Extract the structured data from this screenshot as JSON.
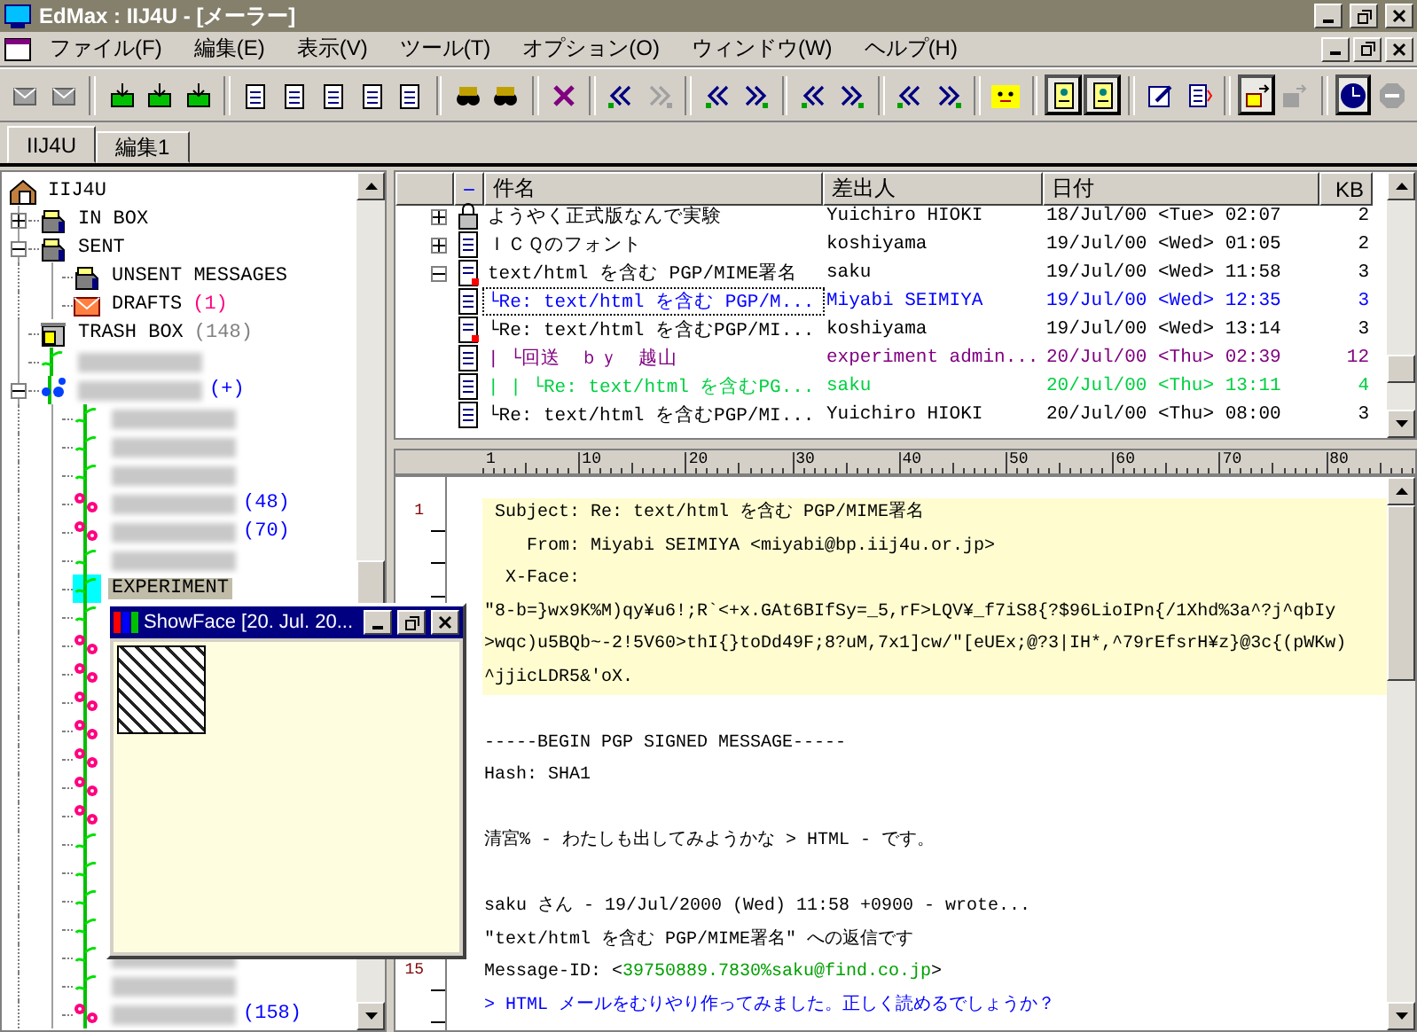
{
  "window": {
    "title": "EdMax : IIJ4U - [メーラー]"
  },
  "menu": [
    "ファイル(F)",
    "編集(E)",
    "表示(V)",
    "ツール(T)",
    "オプション(O)",
    "ウィンドウ(W)",
    "ヘルプ(H)"
  ],
  "toolbar": [
    {
      "kind": "mail",
      "pressed": false,
      "disabled": true
    },
    {
      "kind": "mail",
      "pressed": false,
      "disabled": true
    },
    {
      "kind": "separator"
    },
    {
      "kind": "tray",
      "pressed": false,
      "disabled": false
    },
    {
      "kind": "tray",
      "pressed": false,
      "disabled": false
    },
    {
      "kind": "tray",
      "pressed": false,
      "disabled": false
    },
    {
      "kind": "separator"
    },
    {
      "kind": "doc",
      "pressed": false,
      "disabled": false
    },
    {
      "kind": "doc",
      "pressed": false,
      "disabled": false
    },
    {
      "kind": "doc",
      "pressed": false,
      "disabled": false
    },
    {
      "kind": "doc",
      "pressed": false,
      "disabled": false
    },
    {
      "kind": "doc",
      "pressed": false,
      "disabled": false
    },
    {
      "kind": "separator"
    },
    {
      "kind": "find",
      "pressed": false,
      "disabled": false
    },
    {
      "kind": "find",
      "pressed": false,
      "disabled": false
    },
    {
      "kind": "separator"
    },
    {
      "kind": "delete",
      "pressed": false,
      "disabled": false
    },
    {
      "kind": "separator"
    },
    {
      "kind": "prev",
      "pressed": false,
      "disabled": false
    },
    {
      "kind": "next",
      "pressed": false,
      "disabled": true
    },
    {
      "kind": "separator"
    },
    {
      "kind": "prev",
      "pressed": false,
      "disabled": false
    },
    {
      "kind": "next",
      "pressed": false,
      "disabled": false
    },
    {
      "kind": "separator"
    },
    {
      "kind": "prev",
      "pressed": false,
      "disabled": false
    },
    {
      "kind": "next",
      "pressed": false,
      "disabled": false
    },
    {
      "kind": "separator"
    },
    {
      "kind": "prev",
      "pressed": false,
      "disabled": false
    },
    {
      "kind": "next",
      "pressed": false,
      "disabled": false
    },
    {
      "kind": "separator"
    },
    {
      "kind": "face",
      "pressed": false,
      "disabled": false
    },
    {
      "kind": "separator"
    },
    {
      "kind": "page",
      "pressed": true,
      "disabled": false
    },
    {
      "kind": "page",
      "pressed": true,
      "disabled": false
    },
    {
      "kind": "separator"
    },
    {
      "kind": "edit",
      "pressed": false,
      "disabled": false
    },
    {
      "kind": "list",
      "pressed": false,
      "disabled": false
    },
    {
      "kind": "separator"
    },
    {
      "kind": "move",
      "pressed": true,
      "disabled": false
    },
    {
      "kind": "move",
      "pressed": false,
      "disabled": true
    },
    {
      "kind": "separator"
    },
    {
      "kind": "clock",
      "pressed": true,
      "disabled": false
    },
    {
      "kind": "stop",
      "pressed": false,
      "disabled": true
    }
  ],
  "tabs": [
    {
      "label": "IIJ4U",
      "selected": true
    },
    {
      "label": "編集1",
      "selected": false
    }
  ],
  "tree": {
    "label": "IIJ4U",
    "kind": "account",
    "selected": false,
    "children": [
      {
        "label": "IN BOX",
        "kind": "mailbox",
        "expanded": false,
        "selected": false
      },
      {
        "label": "SENT",
        "kind": "mailbox",
        "expanded": true,
        "selected": false,
        "children": [
          {
            "label": "UNSENT MESSAGES",
            "kind": "mailbox",
            "selected": false
          },
          {
            "label": "DRAFTS",
            "kind": "envelope",
            "count": "(1)",
            "color": "#ff0080",
            "selected": false
          }
        ]
      },
      {
        "label": "TRASH BOX",
        "kind": "trash",
        "count": "(148)",
        "color": "#808080",
        "selected": false
      },
      {
        "kind": "vine",
        "blurred": true,
        "selected": false
      },
      {
        "kind": "blue-flower",
        "blurred": true,
        "count": "(+)",
        "color": "#0000ff",
        "expanded": true,
        "selected": false,
        "children": [
          {
            "kind": "vine",
            "blurred": true,
            "selected": false
          },
          {
            "kind": "vine",
            "blurred": true,
            "selected": false
          },
          {
            "kind": "vine",
            "blurred": true,
            "selected": false
          },
          {
            "kind": "pink-flower",
            "blurred": true,
            "count": "(48)",
            "color": "#0000ff",
            "selected": false
          },
          {
            "kind": "pink-flower",
            "blurred": true,
            "count": "(70)",
            "color": "#0000ff",
            "selected": false
          },
          {
            "kind": "vine",
            "blurred": true,
            "selected": false
          },
          {
            "label": "EXPERIMENT",
            "kind": "vine",
            "selected": true
          },
          {
            "kind": "vine",
            "selected": false
          },
          {
            "kind": "pink-flower",
            "selected": false
          },
          {
            "kind": "pink-flower",
            "selected": false
          },
          {
            "kind": "pink-flower",
            "selected": false
          },
          {
            "kind": "pink-flower",
            "selected": false
          },
          {
            "kind": "pink-flower",
            "selected": false
          },
          {
            "kind": "pink-flower",
            "selected": false
          },
          {
            "kind": "pink-flower",
            "selected": false
          },
          {
            "kind": "vine",
            "selected": false
          },
          {
            "kind": "vine",
            "selected": false
          },
          {
            "kind": "vine",
            "selected": false
          },
          {
            "kind": "vine",
            "selected": false
          },
          {
            "kind": "vine",
            "blurred": true,
            "selected": false
          },
          {
            "kind": "vine",
            "blurred": true,
            "selected": false
          },
          {
            "kind": "pink-flower",
            "blurred": true,
            "count": "(158)",
            "color": "#0000ff",
            "selected": false
          }
        ]
      }
    ]
  },
  "message_list": {
    "columns": [
      "−",
      "件名",
      "差出人",
      "日付",
      "KB"
    ],
    "rows": [
      {
        "expanded": false,
        "kind": "lock",
        "subject": "ようやく正式版なんで実験",
        "sender": "Yuichiro HIOKI",
        "date": "18/Jul/00 <Tue> 02:07",
        "kb": "2",
        "color": "#000000",
        "selected": false
      },
      {
        "expanded": false,
        "kind": "doc",
        "subject": "ＩＣＱのフォント",
        "sender": "koshiyama",
        "date": "19/Jul/00 <Wed> 01:05",
        "kb": "2",
        "color": "#000000",
        "selected": false
      },
      {
        "expanded": true,
        "kind": "signed",
        "subject": "text/html を含む PGP/MIME署名",
        "sender": "saku",
        "date": "19/Jul/00 <Wed> 11:58",
        "kb": "3",
        "color": "#000000",
        "selected": false
      },
      {
        "kind": "doc",
        "subject": "└Re: text/html を含む PGP/M...",
        "sender": "Miyabi SEIMIYA",
        "date": "19/Jul/00 <Wed> 12:35",
        "kb": "3",
        "color": "#0000ff",
        "selected": true
      },
      {
        "kind": "signed",
        "subject": "└Re: text/html を含むPGP/MI...",
        "sender": "koshiyama",
        "date": "19/Jul/00 <Wed> 13:14",
        "kb": "3",
        "color": "#000000",
        "selected": false
      },
      {
        "kind": "doc",
        "subject": "| └回送　ｂｙ　越山",
        "sender": "experiment admin...",
        "date": "20/Jul/00 <Thu> 02:39",
        "kb": "12",
        "color": "#800080",
        "selected": false
      },
      {
        "kind": "doc",
        "subject": "| | └Re: text/html を含むPG...",
        "sender": "saku",
        "date": "20/Jul/00 <Thu> 13:11",
        "kb": "4",
        "color": "#00d040",
        "selected": false
      },
      {
        "kind": "doc",
        "subject": "└Re: text/html を含むPGP/MI...",
        "sender": "Yuichiro HIOKI",
        "date": "20/Jul/00 <Thu> 08:00",
        "kb": "3",
        "color": "#000000",
        "selected": false
      }
    ]
  },
  "ruler": [
    "1",
    "10",
    "20",
    "30",
    "40",
    "50",
    "60",
    "70",
    "80"
  ],
  "message_body": {
    "lines": [
      {
        "kind": "header",
        "number": "1",
        "label": "Subject:",
        "text": "Re: text/html を含む PGP/MIME署名"
      },
      {
        "kind": "header",
        "label": "From:",
        "text": "Miyabi SEIMIYA <miyabi@bp.iij4u.or.jp>"
      },
      {
        "kind": "header",
        "label": "X-Face:"
      },
      {
        "kind": "header",
        "text": "\"8-b=}wx9K%M)qy¥u6!;R`<+x.GAt6BIfSy=_5,rF>LQV¥_f7iS8{?$96LioIPn{/1Xhd%3a^?j^qbIy"
      },
      {
        "kind": "header",
        "text": ">wqc)u5BQb~-2!5V60>thI{}toDd49F;8?uM,7x1]cw/\"[eUEx;@?3|IH*,^79rEfsrH¥z}@3c{(pWKw)"
      },
      {
        "kind": "header",
        "text": "^jjicLDR5&'oX."
      },
      {
        "kind": "blank"
      },
      {
        "kind": "text",
        "text": "-----BEGIN PGP SIGNED MESSAGE-----"
      },
      {
        "kind": "text",
        "text": "Hash: SHA1"
      },
      {
        "kind": "blank"
      },
      {
        "kind": "text",
        "text": "清宮% - わたしも出してみようかな > HTML - です。"
      },
      {
        "kind": "blank"
      },
      {
        "kind": "text",
        "text": "saku さん - 19/Jul/2000 (Wed) 11:58 +0900 - wrote..."
      },
      {
        "kind": "text",
        "text": "\"text/html を含む PGP/MIME署名\" への返信です"
      },
      {
        "kind": "id",
        "number": "15",
        "text": "Message-ID: <",
        "link": "39750889.7830%saku@find.co.jp",
        "tail": ">"
      },
      {
        "kind": "quote",
        "text": "> HTML メールをむりやり作ってみました。正しく読めるでしょうか？"
      }
    ]
  },
  "face_window": {
    "title": "ShowFace [20. Jul. 20..."
  }
}
